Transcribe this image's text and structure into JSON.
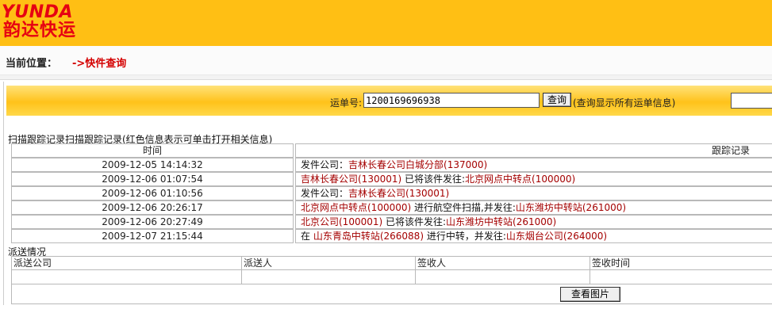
{
  "logo": {
    "en": "YUNDA",
    "cn": "韵达快运"
  },
  "location": {
    "label": "当前位置：",
    "path": "->快件查询"
  },
  "search": {
    "label": "运单号:",
    "value": "1200169696938",
    "button": "查询",
    "hint": "(查询显示所有运单信息)"
  },
  "tracking": {
    "caption": "扫描跟踪记录扫描跟踪记录(红色信息表示可单击打开相关信息)",
    "headers": {
      "time": "时间",
      "record": "跟踪记录"
    },
    "rows": [
      {
        "time": "2009-12-05 14:14:32",
        "parts": [
          {
            "t": "发件公司：",
            "c": "black"
          },
          {
            "t": "吉林长春公司白城分部(137000)",
            "c": "red"
          }
        ]
      },
      {
        "time": "2009-12-06 01:07:54",
        "parts": [
          {
            "t": "吉林长春公司(130001)",
            "c": "red"
          },
          {
            "t": " 已将该件发往:",
            "c": "black"
          },
          {
            "t": "北京网点中转点(100000)",
            "c": "red"
          }
        ]
      },
      {
        "time": "2009-12-06 01:10:56",
        "parts": [
          {
            "t": "发件公司：",
            "c": "black"
          },
          {
            "t": "吉林长春公司(130001)",
            "c": "red"
          }
        ]
      },
      {
        "time": "2009-12-06 20:26:17",
        "parts": [
          {
            "t": "北京网点中转点(100000)",
            "c": "red"
          },
          {
            "t": " 进行航空件扫描,并发往:",
            "c": "black"
          },
          {
            "t": "山东潍坊中转站(261000)",
            "c": "red"
          }
        ]
      },
      {
        "time": "2009-12-06 20:27:49",
        "parts": [
          {
            "t": "北京公司(100001)",
            "c": "red"
          },
          {
            "t": " 已将该件发往:",
            "c": "black"
          },
          {
            "t": "山东潍坊中转站(261000)",
            "c": "red"
          }
        ]
      },
      {
        "time": "2009-12-07 21:15:44",
        "parts": [
          {
            "t": "在 ",
            "c": "black"
          },
          {
            "t": "山东青岛中转站(266088)",
            "c": "red"
          },
          {
            "t": " 进行中转，并发往:",
            "c": "black"
          },
          {
            "t": "山东烟台公司(264000)",
            "c": "red"
          }
        ]
      }
    ]
  },
  "dispatch": {
    "caption": "派送情况",
    "headers": [
      "派送公司",
      "派送人",
      "签收人",
      "签收时间"
    ],
    "view_button": "查看图片"
  },
  "colors": {
    "header": "#ffbf14",
    "accent_red": "#a40000",
    "logo_red": "#e60012"
  }
}
